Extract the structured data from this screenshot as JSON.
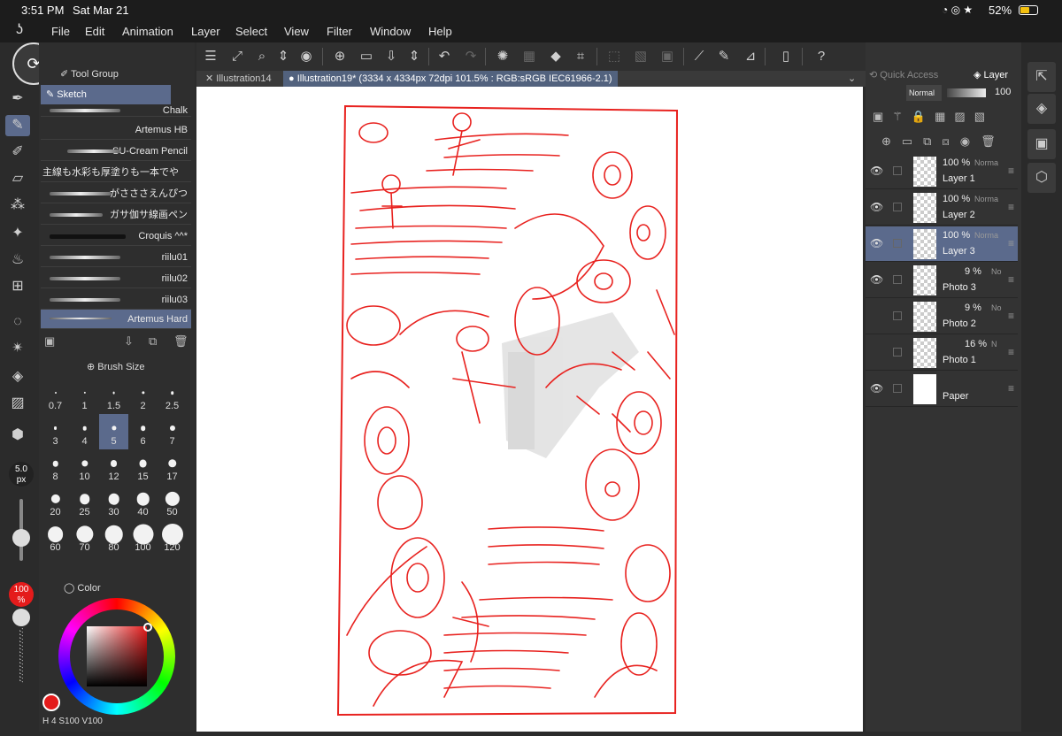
{
  "status": {
    "time": "3:51 PM",
    "date": "Sat Mar 21",
    "battery": "52%"
  },
  "menu": [
    "File",
    "Edit",
    "Animation",
    "Layer",
    "Select",
    "View",
    "Filter",
    "Window",
    "Help"
  ],
  "tabs": {
    "tab1": "Illustration14",
    "tab2": "Illustration19* (3334 x 4334px 72dpi 101.5% : RGB:sRGB IEC61966-2.1)"
  },
  "toolgroup": {
    "title": "Tool Group",
    "sub": "Sketch"
  },
  "brushes": [
    "Chalk",
    "Artemus HB",
    "SU-Cream Pencil",
    "主線も水彩も厚塗りも一本でやる",
    "がさささえんぴつ",
    "ガサ伽サ線画ペン",
    "Croquis ^^*",
    "riilu01",
    "riilu02",
    "riilu03",
    "Artemus Hard"
  ],
  "brushsize": {
    "title": "Brush Size",
    "sizes": [
      "0.7",
      "1",
      "1.5",
      "2",
      "2.5",
      "3",
      "4",
      "5",
      "6",
      "7",
      "8",
      "10",
      "12",
      "15",
      "17",
      "20",
      "25",
      "30",
      "40",
      "50",
      "60",
      "70",
      "80",
      "100",
      "120"
    ],
    "selected": "5"
  },
  "slider": {
    "size": "5.0",
    "unit": "px",
    "opacity": "100",
    "opacity_unit": "%"
  },
  "color": {
    "title": "Color",
    "main": "#e41b1b",
    "bottom": [
      "4",
      "100",
      "100"
    ],
    "bottom_labels": [
      "H",
      "S",
      "V"
    ]
  },
  "layerpanel": {
    "tab_quick": "Quick Access",
    "tab_layer": "Layer",
    "blend": "Normal",
    "opacity": "100"
  },
  "layers": [
    {
      "pct": "100 %",
      "mode": "Norma",
      "name": "Layer 1",
      "visible": true
    },
    {
      "pct": "100 %",
      "mode": "Norma",
      "name": "Layer 2",
      "visible": true
    },
    {
      "pct": "100 %",
      "mode": "Norma",
      "name": "Layer 3",
      "visible": true,
      "selected": true
    },
    {
      "pct": "9 %",
      "mode": "No",
      "name": "Photo 3",
      "visible": true
    },
    {
      "pct": "9 %",
      "mode": "No",
      "name": "Photo 2",
      "visible": false
    },
    {
      "pct": "16 %",
      "mode": "N",
      "name": "Photo 1",
      "visible": false
    },
    {
      "pct": "",
      "mode": "",
      "name": "Paper",
      "visible": true
    }
  ],
  "colors": {
    "sketch_red": "#e8221f",
    "selection": "#5b6a8c"
  }
}
